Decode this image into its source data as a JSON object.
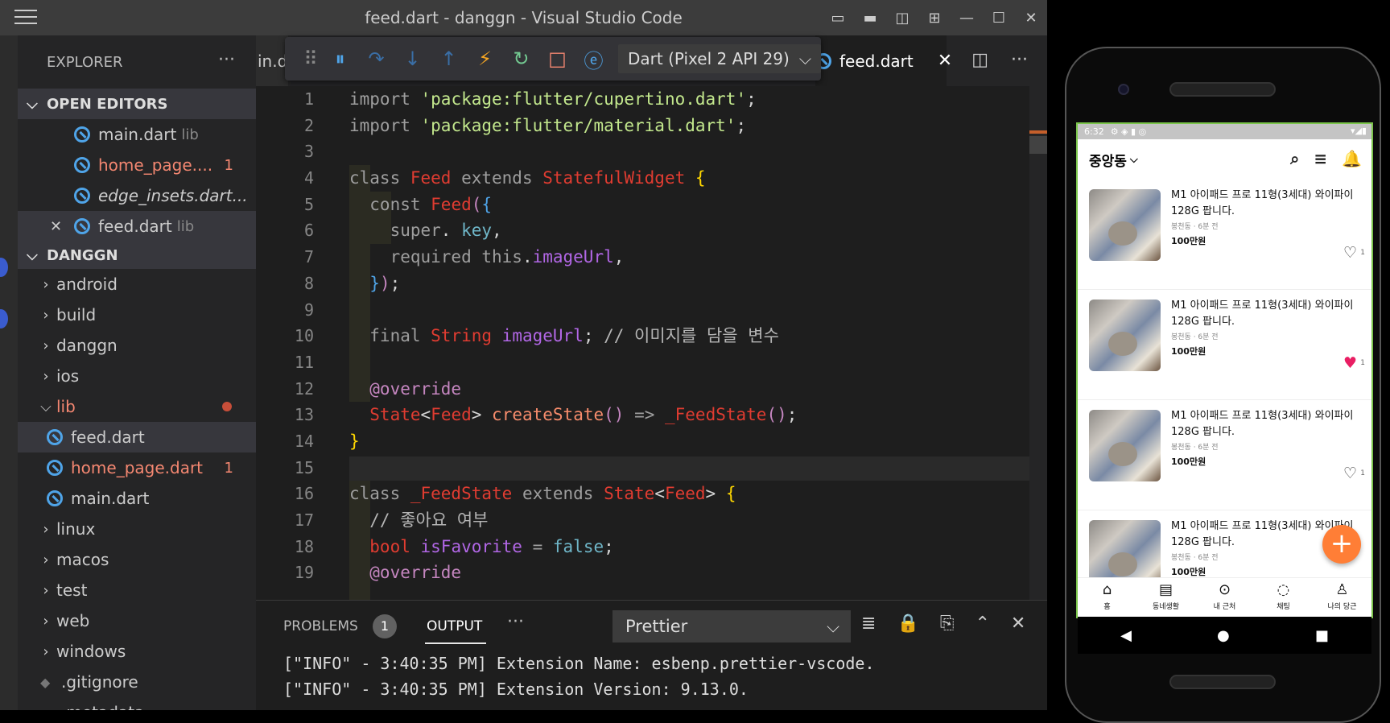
{
  "window": {
    "title": "feed.dart - danggn - Visual Studio Code",
    "controls": [
      "▭",
      "▬",
      "◫",
      "⊞",
      "—",
      "☐",
      "✕"
    ]
  },
  "explorer": {
    "header": "EXPLORER",
    "more": "···",
    "open_editors": {
      "label": "OPEN EDITORS",
      "items": [
        {
          "name": "main.dart",
          "desc": "lib"
        },
        {
          "name": "home_page....",
          "badge": "1"
        },
        {
          "name": "edge_insets.dart..."
        },
        {
          "name": "feed.dart",
          "desc": "lib",
          "close": "✕"
        }
      ]
    },
    "project": {
      "label": "DANGGN",
      "folders": [
        "android",
        "build",
        "danggn",
        "ios"
      ],
      "lib": {
        "label": "lib",
        "files": [
          {
            "name": "feed.dart"
          },
          {
            "name": "home_page.dart",
            "badge": "1"
          },
          {
            "name": "main.dart"
          }
        ]
      },
      "folders_after": [
        "linux",
        "macos",
        "test",
        "web",
        "windows"
      ],
      "files_after": [
        ".gitignore",
        ".metadata"
      ]
    }
  },
  "tabs": {
    "partial": "in.d",
    "active": "feed.dart",
    "close": "✕",
    "actions": [
      "◫",
      "···"
    ]
  },
  "debug_toolbar": {
    "icons": [
      "⠿",
      "⏸",
      "↷",
      "↓",
      "↑",
      "⚡",
      "↻",
      "□",
      "ⓔ"
    ],
    "target": "Dart (Pixel 2 API 29)"
  },
  "editor": {
    "line_numbers": [
      "1",
      "2",
      "3",
      "4",
      "5",
      "6",
      "7",
      "8",
      "9",
      "10",
      "11",
      "12",
      "13",
      "14",
      "15",
      "16",
      "17",
      "18",
      "19"
    ],
    "lines": [
      [
        [
          "kw",
          "import "
        ],
        [
          "str",
          "'package:flutter/cupertino.dart'"
        ],
        [
          "",
          "; "
        ]
      ],
      [
        [
          "kw",
          "import "
        ],
        [
          "str",
          "'package:flutter/material.dart'"
        ],
        [
          "",
          ";"
        ]
      ],
      [],
      [
        [
          "kw",
          "class "
        ],
        [
          "cls",
          "Feed"
        ],
        [
          "kw",
          " extends "
        ],
        [
          "cls",
          "StatefulWidget"
        ],
        [
          "yel",
          " {"
        ]
      ],
      [
        [
          "kw",
          "  const "
        ],
        [
          "cls",
          "Feed"
        ],
        [
          "pur",
          "("
        ],
        [
          "blu",
          "{"
        ]
      ],
      [
        [
          "kw",
          "    super"
        ],
        [
          "",
          ". "
        ],
        [
          "teal",
          "key"
        ],
        [
          "",
          ","
        ]
      ],
      [
        [
          "kw",
          "    required this"
        ],
        [
          "",
          "."
        ],
        [
          "prp",
          "imageUrl"
        ],
        [
          "",
          ","
        ]
      ],
      [
        [
          "blu",
          "  }"
        ],
        [
          "pur",
          ")"
        ],
        [
          "",
          ";"
        ]
      ],
      [],
      [
        [
          "kw",
          "  final "
        ],
        [
          "cls",
          "String "
        ],
        [
          "prp",
          "imageUrl"
        ],
        [
          "",
          ";"
        ],
        [
          "cm",
          " // 이미지를 담을 변수"
        ]
      ],
      [],
      [
        [
          "pur",
          "  @override"
        ]
      ],
      [
        [
          "cls",
          "  State"
        ],
        [
          "",
          "<"
        ],
        [
          "cls",
          "Feed"
        ],
        [
          "",
          "> "
        ],
        [
          "org",
          "createState"
        ],
        [
          "pur",
          "()"
        ],
        [
          "kw",
          " => "
        ],
        [
          "cls",
          "_FeedState"
        ],
        [
          "pur",
          "()"
        ],
        [
          "",
          ";"
        ]
      ],
      [
        [
          "yel",
          "}"
        ]
      ],
      [],
      [
        [
          "kw",
          "class "
        ],
        [
          "cls",
          "_FeedState"
        ],
        [
          "kw",
          " extends "
        ],
        [
          "cls",
          "State"
        ],
        [
          "",
          "<"
        ],
        [
          "cls",
          "Feed"
        ],
        [
          "",
          "> "
        ],
        [
          "yel",
          "{"
        ]
      ],
      [
        [
          "cm",
          "  // 좋아요 여부"
        ]
      ],
      [
        [
          "cls",
          "  bool "
        ],
        [
          "prp",
          "isFavorite"
        ],
        [
          "kw",
          " = "
        ],
        [
          "teal",
          "false"
        ],
        [
          "",
          ";"
        ]
      ],
      [
        [
          "pur",
          "  @override"
        ]
      ]
    ]
  },
  "panel": {
    "problems": "PROBLEMS",
    "problems_count": "1",
    "output": "OUTPUT",
    "more": "···",
    "channel": "Prettier",
    "actions": [
      "≣",
      "🔒",
      "⎘",
      "⌃",
      "✕"
    ],
    "lines": [
      "[\"INFO\" - 3:40:35 PM] Extension Name: esbenp.prettier-vscode.",
      "[\"INFO\" - 3:40:35 PM] Extension Version: 9.13.0."
    ]
  },
  "phone": {
    "status_time": "6:32",
    "status_icons": "⚙ ◈ ▮ ◎",
    "status_right": "▾◢▮",
    "location": "중앙동",
    "appbar_icons": [
      "⌕",
      "≡",
      "🔔"
    ],
    "items": [
      {
        "title": "M1 아이패드 프로 11형(3세대) 와이파이 128G 팝니다.",
        "meta": "봉천동 · 6분 전",
        "price": "100만원",
        "liked": false,
        "likes": "1"
      },
      {
        "title": "M1 아이패드 프로 11형(3세대) 와이파이 128G 팝니다.",
        "meta": "봉천동 · 6분 전",
        "price": "100만원",
        "liked": true,
        "likes": "1"
      },
      {
        "title": "M1 아이패드 프로 11형(3세대) 와이파이 128G 팝니다.",
        "meta": "봉천동 · 6분 전",
        "price": "100만원",
        "liked": false,
        "likes": "1"
      },
      {
        "title": "M1 아이패드 프로 11형(3세대) 와이파이 128G 팝니다.",
        "meta": "봉천동 · 6분 전",
        "price": "100만원",
        "liked": false,
        "likes": ""
      }
    ],
    "fab": "+",
    "bottom_nav": [
      {
        "icon": "⌂",
        "label": "홈"
      },
      {
        "icon": "▤",
        "label": "동네생활"
      },
      {
        "icon": "⊙",
        "label": "내 근처"
      },
      {
        "icon": "◌",
        "label": "채팅"
      },
      {
        "icon": "♙",
        "label": "나의 당근"
      }
    ],
    "android_nav": [
      "◀",
      "●",
      "■"
    ]
  },
  "colors": {
    "accent": "#ff7e36",
    "liked": "#e91e63",
    "error": "#f48771"
  }
}
